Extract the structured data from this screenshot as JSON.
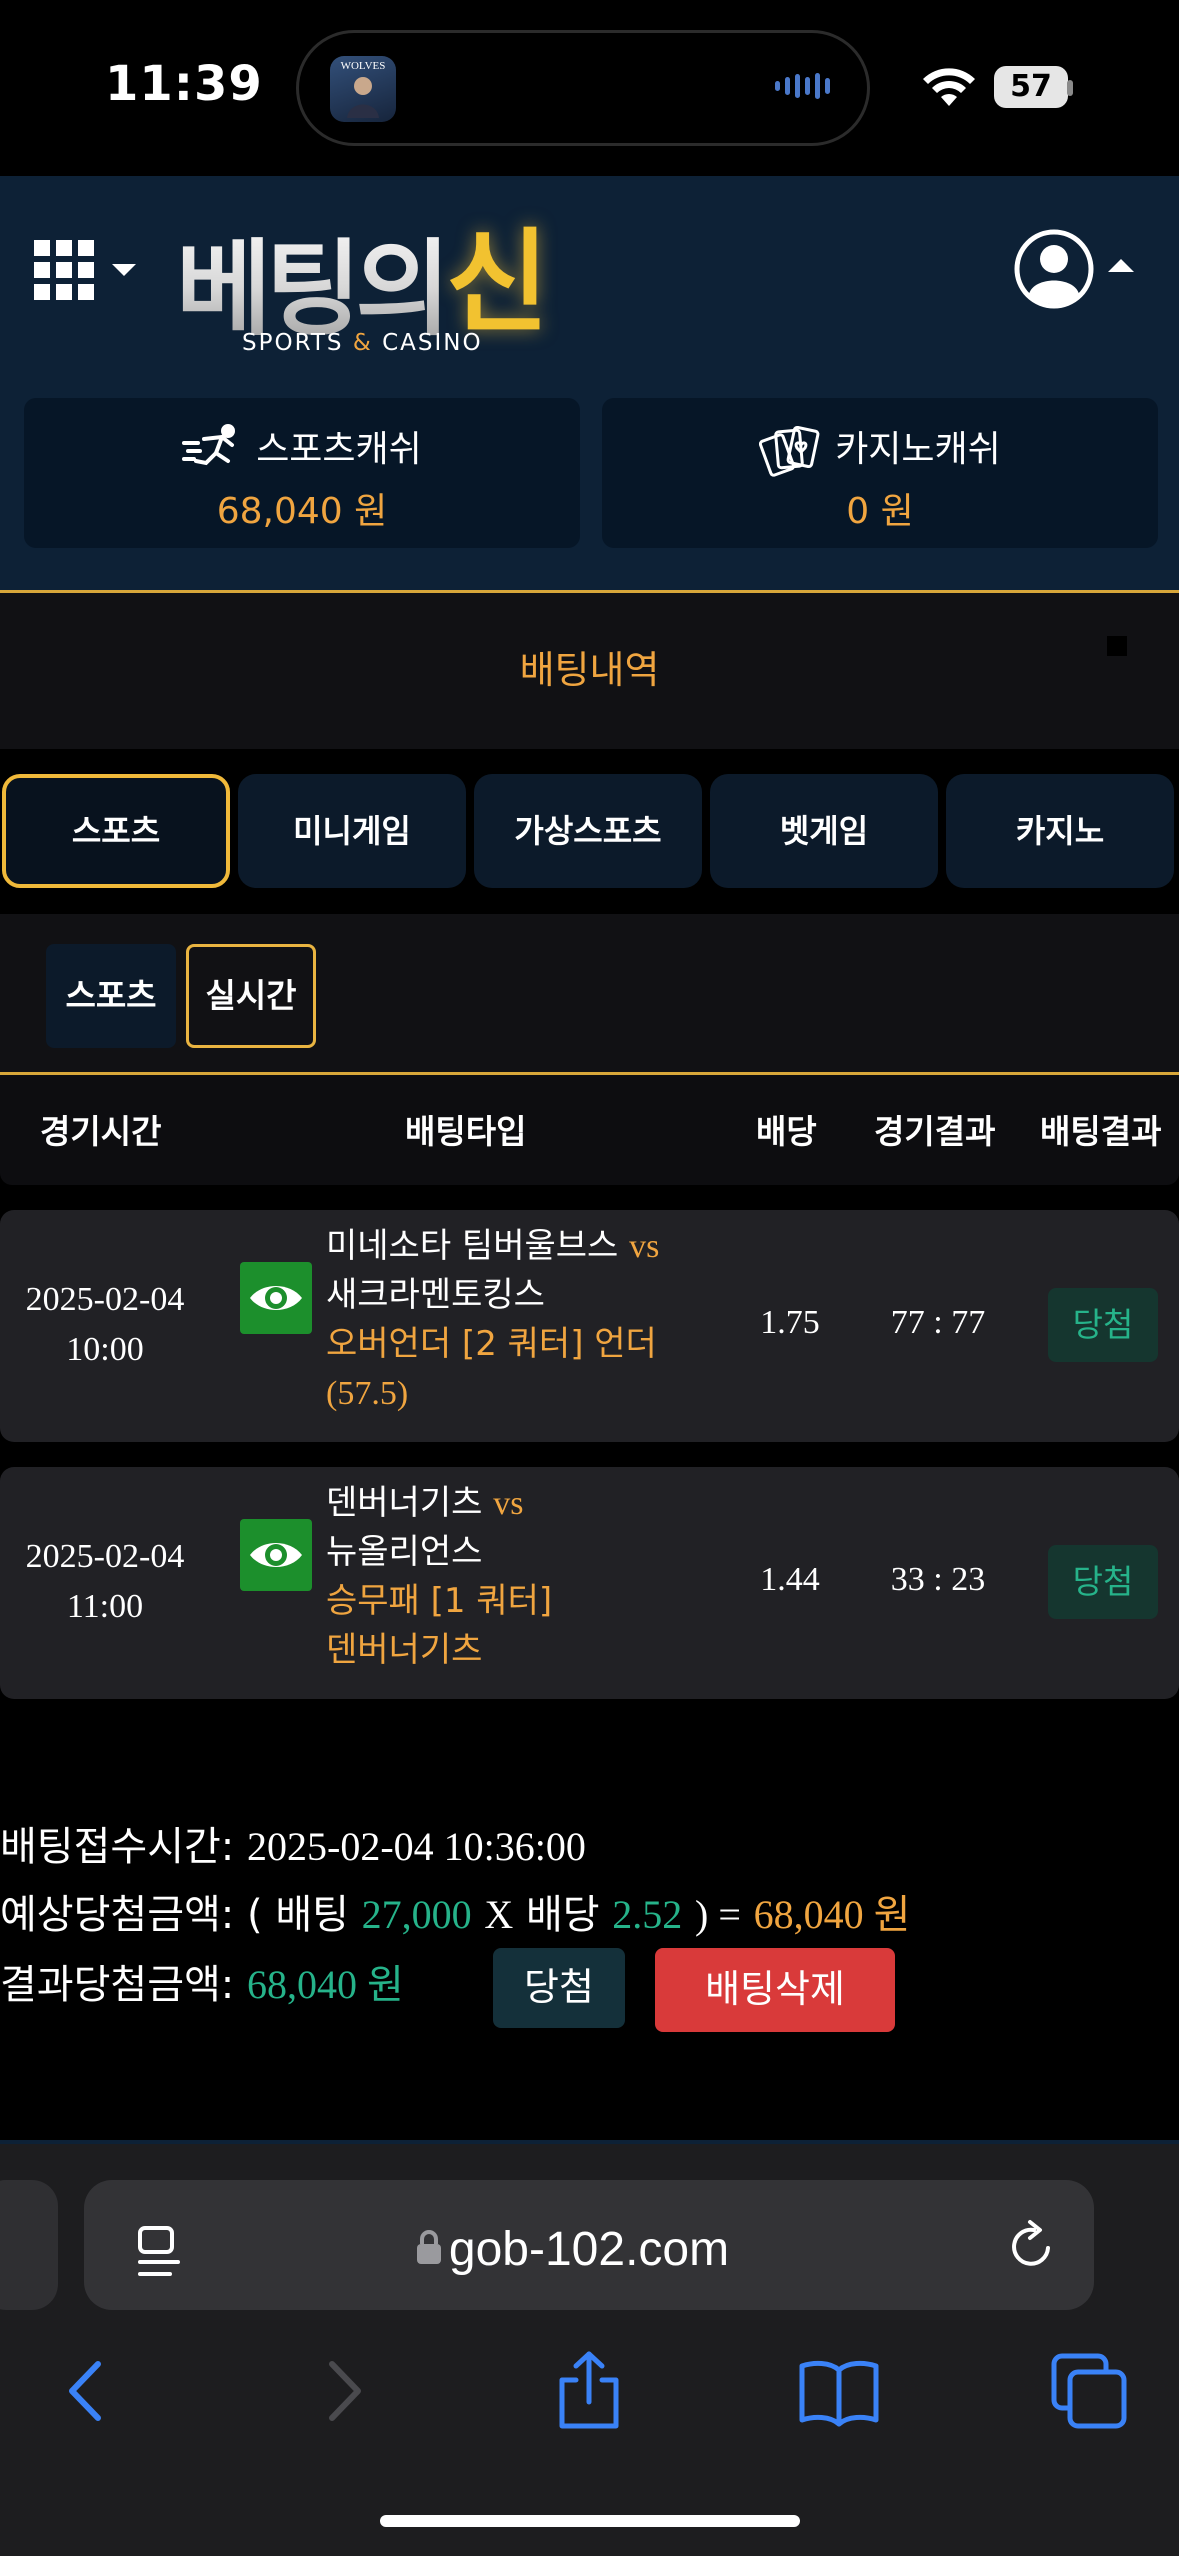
{
  "status_bar": {
    "time": "11:39",
    "island_app_label": "WOLVES",
    "battery": "57"
  },
  "header": {
    "logo_main": "베팅의",
    "logo_accent": "신",
    "logo_sub_left": "SPORTS",
    "logo_sub_amp": "&",
    "logo_sub_right": "CASINO"
  },
  "wallets": {
    "sports": {
      "label": "스포츠캐쉬",
      "amount": "68,040 원"
    },
    "casino": {
      "label": "카지노캐쉬",
      "amount": "0 원"
    }
  },
  "page": {
    "title": "배팅내역"
  },
  "tabs": [
    {
      "label": "스포츠",
      "active": true
    },
    {
      "label": "미니게임",
      "active": false
    },
    {
      "label": "가상스포츠",
      "active": false
    },
    {
      "label": "벳게임",
      "active": false
    },
    {
      "label": "카지노",
      "active": false
    }
  ],
  "subtabs": {
    "sports": "스포츠",
    "live": "실시간"
  },
  "table": {
    "headers": {
      "time": "경기시간",
      "type": "배팅타입",
      "odds": "배당",
      "score": "경기결과",
      "result": "배팅결과"
    },
    "rows": [
      {
        "date": "2025-02-04",
        "time": "10:00",
        "home": "미네소타 팀버울브스",
        "vs": "vs",
        "away": "새크라멘토킹스",
        "market": "오버언더 [2 쿼터] 언더",
        "pick": "(57.5)",
        "odds": "1.75",
        "score": "77 : 77",
        "result": "당첨"
      },
      {
        "date": "2025-02-04",
        "time": "11:00",
        "home": "덴버너기츠",
        "vs": "vs",
        "away": "뉴올리언스",
        "market": "승무패 [1 쿼터]",
        "pick": "덴버너기츠",
        "odds": "1.44",
        "score": "33 : 23",
        "result": "당첨"
      }
    ]
  },
  "summary": {
    "received_label": "배팅접수시간:",
    "received_value": "2025-02-04 10:36:00",
    "expected_label": "예상당첨금액:",
    "expected_open": "( 배팅",
    "stake": "27,000",
    "times": "X",
    "odds_label": "배당",
    "total_odds": "2.52",
    "expected_close": ") =",
    "expected_amount": "68,040 원",
    "result_label": "결과당첨금액:",
    "result_amount": "68,040 원",
    "won_button": "당첨",
    "delete_button": "배팅삭제"
  },
  "browser": {
    "url": "gob-102.com"
  },
  "colors": {
    "accent_orange": "#f0a540",
    "win_green": "#26b38a",
    "gold_border": "#f0b93a",
    "delete_red": "#d93a3a",
    "header_navy": "#0d2136"
  }
}
